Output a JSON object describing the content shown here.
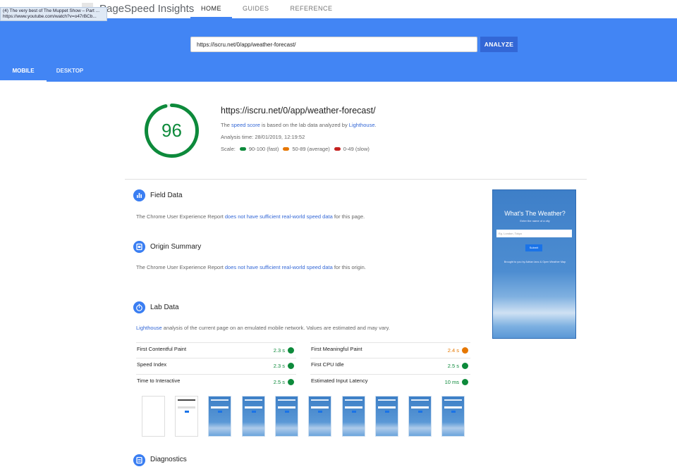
{
  "app": {
    "brand": "PageSpeed Insights",
    "nav": [
      "HOME",
      "GUIDES",
      "REFERENCE"
    ],
    "active_nav": "HOME"
  },
  "tooltip": {
    "line1": "(4) The very best of The Muppet Show – Part ...",
    "line2": "https://www.youtube.com/watch?v=o47rBCb..."
  },
  "search": {
    "value": "https://iscru.net/0/app/weather-forecast/",
    "button": "ANALYZE"
  },
  "tabs": [
    "MOBILE",
    "DESKTOP"
  ],
  "summary": {
    "score": "96",
    "score_fraction": 0.96,
    "url": "https://iscru.net/0/app/weather-forecast/",
    "desc_pre": "The ",
    "desc_link1": "speed score",
    "desc_mid": " is based on the lab data analyzed by ",
    "desc_link2": "Lighthouse",
    "desc_post": ".",
    "analysis_time": "Analysis time: 28/01/2019, 12:19:52",
    "scale_label": "Scale:",
    "scale": [
      {
        "label": "90-100 (fast)",
        "color": "#0d8a3b"
      },
      {
        "label": "50-89 (average)",
        "color": "#e67700"
      },
      {
        "label": "0-49 (slow)",
        "color": "#c5221f"
      }
    ]
  },
  "field_data": {
    "title": "Field Data",
    "text_pre": "The Chrome User Experience Report ",
    "link": "does not have sufficient real-world speed data",
    "text_post": " for this page."
  },
  "origin_summary": {
    "title": "Origin Summary",
    "text_pre": "The Chrome User Experience Report ",
    "link": "does not have sufficient real-world speed data",
    "text_post": " for this origin."
  },
  "lab_data": {
    "title": "Lab Data",
    "link": "Lighthouse",
    "text_post": " analysis of the current page on an emulated mobile network. Values are estimated and may vary.",
    "metrics_left": [
      {
        "label": "First Contentful Paint",
        "value": "2.3 s",
        "status": "good"
      },
      {
        "label": "Speed Index",
        "value": "2.3 s",
        "status": "good"
      },
      {
        "label": "Time to Interactive",
        "value": "2.5 s",
        "status": "good"
      }
    ],
    "metrics_right": [
      {
        "label": "First Meaningful Paint",
        "value": "2.4 s",
        "status": "average"
      },
      {
        "label": "First CPU Idle",
        "value": "2.5 s",
        "status": "good"
      },
      {
        "label": "Estimated Input Latency",
        "value": "10 ms",
        "status": "good"
      }
    ]
  },
  "diagnostics": {
    "title": "Diagnostics"
  },
  "phone_preview": {
    "title": "What's The Weather?",
    "subtitle": "Enter the name of a city",
    "input_placeholder": "Eg. London, Tokyo",
    "button": "Submit",
    "footer": "Brought to you by Adrian Ianc & Open Weather Map"
  },
  "colors": {
    "accent": "#4285f4",
    "button": "#3367d6",
    "good": "#0d8a3b",
    "average": "#e67700"
  }
}
